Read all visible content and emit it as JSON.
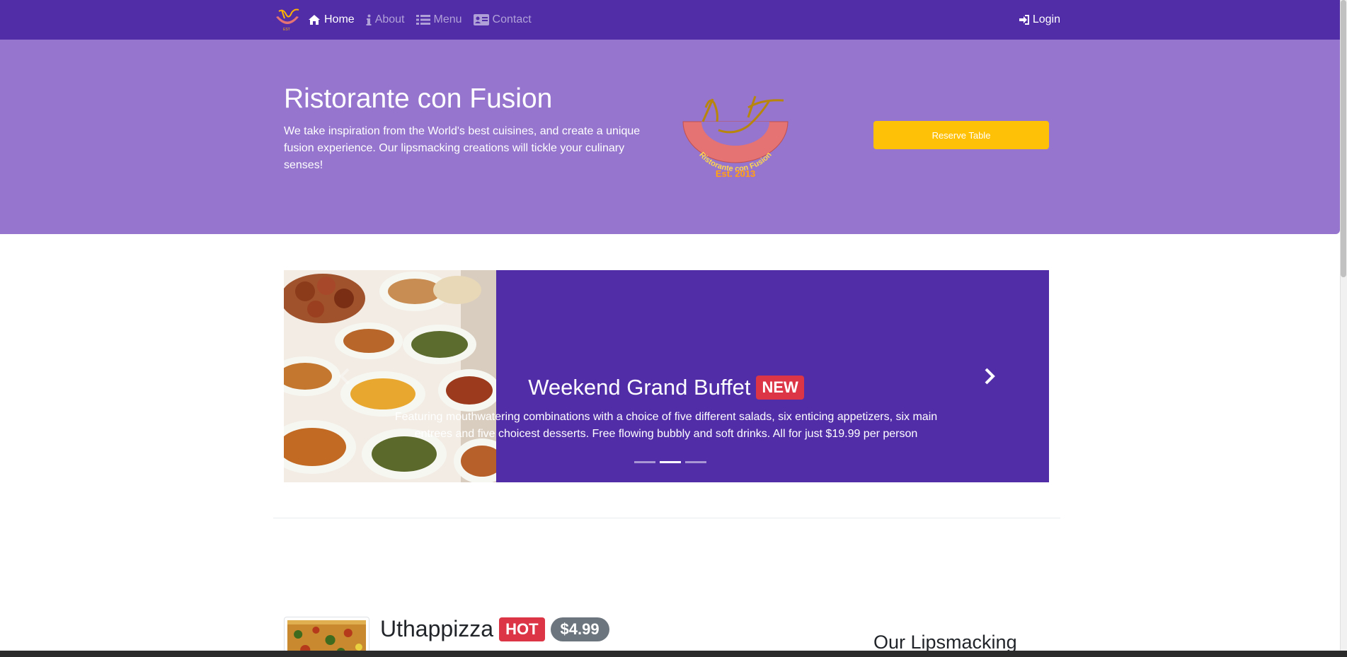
{
  "navbar": {
    "brand_icon": "restaurant-logo",
    "links": [
      {
        "label": "Home",
        "icon": "home-icon",
        "active": true
      },
      {
        "label": "About",
        "icon": "info-icon",
        "active": false
      },
      {
        "label": "Menu",
        "icon": "list-icon",
        "active": false
      },
      {
        "label": "Contact",
        "icon": "address-card-icon",
        "active": false
      }
    ],
    "login": {
      "label": "Login",
      "icon": "sign-in-icon"
    }
  },
  "jumbotron": {
    "title": "Ristorante con Fusion",
    "text": "We take inspiration from the World's best cuisines, and create a unique fusion experience. Our lipsmacking creations will tickle your culinary senses!",
    "logo_text": "Ristorante con Fusion",
    "logo_est": "Est. 2013",
    "reserve_label": "Reserve Table"
  },
  "carousel": {
    "title": "Weekend Grand Buffet",
    "badge": "NEW",
    "description": "Featuring mouthwatering combinations with a choice of five different salads, six enticing appetizers, six main entrees and five choicest desserts. Free flowing bubbly and soft drinks. All for just $19.99 per person",
    "active_slide": 2,
    "slide_count": 3
  },
  "dish": {
    "name": "Uthappizza",
    "badge": "HOT",
    "price": "$4.99"
  },
  "sidebar": {
    "heading": "Our Lipsmacking"
  },
  "colors": {
    "primary": "#512da8",
    "jumbotron": "#9575cd",
    "warning": "#ffc107",
    "danger": "#dc3545",
    "secondary": "#6c757d"
  }
}
